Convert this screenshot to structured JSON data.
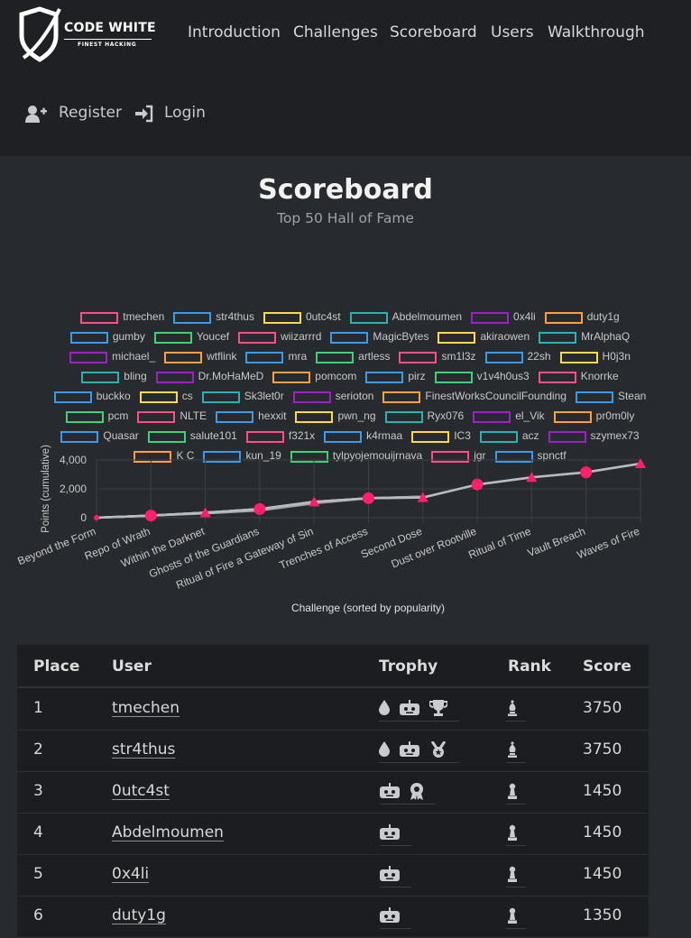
{
  "brand": {
    "name": "CODE WHITE",
    "tagline": "FINEST HACKING"
  },
  "nav": {
    "links": [
      "Introduction",
      "Challenges",
      "Scoreboard",
      "Users",
      "Walkthrough"
    ],
    "register": "Register",
    "login": "Login"
  },
  "page": {
    "title": "Scoreboard",
    "subtitle": "Top 50 Hall of Fame"
  },
  "legend": [
    {
      "name": "tmechen",
      "color": "#ff4d8a"
    },
    {
      "name": "str4thus",
      "color": "#3b9bea"
    },
    {
      "name": "0utc4st",
      "color": "#ffd84d"
    },
    {
      "name": "Abdelmoumen",
      "color": "#2ab3b3"
    },
    {
      "name": "0x4li",
      "color": "#a020c8"
    },
    {
      "name": "duty1g",
      "color": "#ff9f40"
    },
    {
      "name": "gumby",
      "color": "#3b9bea"
    },
    {
      "name": "Youcef",
      "color": "#3fd175"
    },
    {
      "name": "wiizarrrd",
      "color": "#ff4d8a"
    },
    {
      "name": "MagicBytes",
      "color": "#3b9bea"
    },
    {
      "name": "akiraowen",
      "color": "#ffd84d"
    },
    {
      "name": "MrAlphaQ",
      "color": "#2ab3b3"
    },
    {
      "name": "michael_",
      "color": "#a020c8"
    },
    {
      "name": "wtflink",
      "color": "#ff9f40"
    },
    {
      "name": "mra",
      "color": "#3b9bea"
    },
    {
      "name": "artless",
      "color": "#3fd175"
    },
    {
      "name": "sm1l3z",
      "color": "#ff4d8a"
    },
    {
      "name": "22sh",
      "color": "#3b9bea"
    },
    {
      "name": "H0j3n",
      "color": "#ffd84d"
    },
    {
      "name": "bling",
      "color": "#2ab3b3"
    },
    {
      "name": "Dr.MoHaMeD",
      "color": "#a020c8"
    },
    {
      "name": "pomcom",
      "color": "#ff9f40"
    },
    {
      "name": "pirz",
      "color": "#3b9bea"
    },
    {
      "name": "v1v4h0us3",
      "color": "#3fd175"
    },
    {
      "name": "Knorrke",
      "color": "#ff4d8a"
    },
    {
      "name": "buckko",
      "color": "#3b9bea"
    },
    {
      "name": "cs",
      "color": "#ffd84d"
    },
    {
      "name": "Sk3let0r",
      "color": "#2ab3b3"
    },
    {
      "name": "serioton",
      "color": "#a020c8"
    },
    {
      "name": "FinestWorksCouncilFounding",
      "color": "#ff9f40"
    },
    {
      "name": "Stean",
      "color": "#3b9bea"
    },
    {
      "name": "pcm",
      "color": "#3fd175"
    },
    {
      "name": "NLTE",
      "color": "#ff4d8a"
    },
    {
      "name": "hexxit",
      "color": "#3b9bea"
    },
    {
      "name": "pwn_ng",
      "color": "#ffd84d"
    },
    {
      "name": "Ryx076",
      "color": "#2ab3b3"
    },
    {
      "name": "el_Vik",
      "color": "#a020c8"
    },
    {
      "name": "pr0m0ly",
      "color": "#ff9f40"
    },
    {
      "name": "Quasar",
      "color": "#3b9bea"
    },
    {
      "name": "salute101",
      "color": "#3fd175"
    },
    {
      "name": "f321x",
      "color": "#ff4d8a"
    },
    {
      "name": "k4rmaa",
      "color": "#3b9bea"
    },
    {
      "name": "IC3",
      "color": "#ffd84d"
    },
    {
      "name": "acz",
      "color": "#2ab3b3"
    },
    {
      "name": "szymex73",
      "color": "#a020c8"
    },
    {
      "name": "K C",
      "color": "#ff9f40"
    },
    {
      "name": "kun_19",
      "color": "#3b9bea"
    },
    {
      "name": "tylpyojemouijrnava",
      "color": "#3fd175"
    },
    {
      "name": "jgr",
      "color": "#ff4d8a"
    },
    {
      "name": "spnctf",
      "color": "#3b9bea"
    }
  ],
  "chart_data": {
    "type": "line",
    "xlabel": "Challenge (sorted by popularity)",
    "ylabel": "Points (cumulative)",
    "categories": [
      "Beyond the Form",
      "Repo of Wrath",
      "Within the Darknet",
      "Ghosts of the Guardians",
      "Ritual of Fire a Gateway of Sin",
      "Trenches of Access",
      "Second Dose",
      "Dust over Rootville",
      "Ritual of Time",
      "Vault Breach",
      "Waves of Fire"
    ],
    "yticks": [
      "0",
      "2,000",
      "4,000"
    ],
    "ylim": [
      0,
      4000
    ],
    "series": [
      {
        "name": "tmechen",
        "color": "#ff4d8a",
        "values": [
          0,
          150,
          350,
          600,
          1100,
          1350,
          1400,
          2300,
          2800,
          3150,
          3750
        ]
      },
      {
        "name": "str4thus",
        "color": "#a0a4ab",
        "values": [
          0,
          150,
          350,
          600,
          1100,
          1350,
          1400,
          2300,
          2800,
          3150,
          3750
        ]
      },
      {
        "name": "0utc4st",
        "color": "#a0a4ab",
        "values": [
          0,
          150,
          350,
          600,
          1100,
          1350,
          1450,
          null,
          null,
          null,
          null
        ]
      },
      {
        "name": "Abdelmoumen",
        "color": "#a0a4ab",
        "values": [
          0,
          150,
          350,
          600,
          1100,
          1350,
          1450,
          null,
          null,
          null,
          null
        ]
      },
      {
        "name": "0x4li",
        "color": "#a0a4ab",
        "values": [
          0,
          150,
          350,
          600,
          1100,
          1350,
          1450,
          null,
          null,
          null,
          null
        ]
      },
      {
        "name": "duty1g",
        "color": "#a0a4ab",
        "values": [
          0,
          150,
          300,
          500,
          1000,
          1350,
          null,
          null,
          null,
          null,
          null
        ]
      }
    ]
  },
  "table": {
    "headers": [
      "Place",
      "User",
      "Trophy",
      "Rank",
      "Score"
    ],
    "rows": [
      {
        "place": "1",
        "user": "tmechen",
        "trophies": [
          "drop-icon",
          "robot-icon",
          "trophy-icon"
        ],
        "rank_icon": "chess-bishop-icon",
        "score": "3750"
      },
      {
        "place": "2",
        "user": "str4thus",
        "trophies": [
          "drop-icon",
          "robot-icon",
          "medal-icon"
        ],
        "rank_icon": "chess-bishop-icon",
        "score": "3750"
      },
      {
        "place": "3",
        "user": "0utc4st",
        "trophies": [
          "robot-icon",
          "award-icon"
        ],
        "rank_icon": "chess-pawn-icon",
        "score": "1450"
      },
      {
        "place": "4",
        "user": "Abdelmoumen",
        "trophies": [
          "robot-icon"
        ],
        "rank_icon": "chess-pawn-icon",
        "score": "1450"
      },
      {
        "place": "5",
        "user": "0x4li",
        "trophies": [
          "robot-icon"
        ],
        "rank_icon": "chess-pawn-icon",
        "score": "1450"
      },
      {
        "place": "6",
        "user": "duty1g",
        "trophies": [
          "robot-icon"
        ],
        "rank_icon": "chess-pawn-icon",
        "score": "1350"
      }
    ]
  }
}
